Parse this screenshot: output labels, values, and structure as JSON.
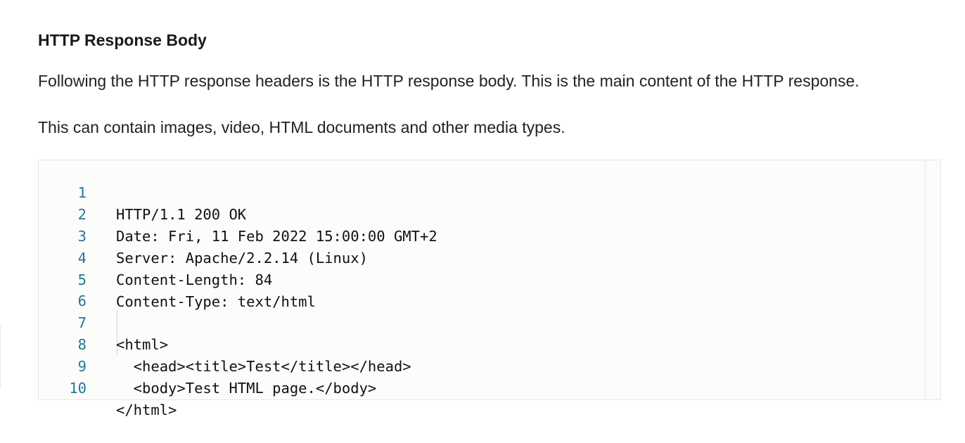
{
  "section": {
    "heading": "HTTP Response Body",
    "paragraphs": [
      "Following the HTTP response headers is the HTTP response body. This is the main content of the HTTP response.",
      "This can contain images, video, HTML documents and other media types."
    ]
  },
  "code_block": {
    "lines": [
      {
        "number": "1",
        "text": "HTTP/1.1 200 OK"
      },
      {
        "number": "2",
        "text": "Date: Fri, 11 Feb 2022 15:00:00 GMT+2"
      },
      {
        "number": "3",
        "text": "Server: Apache/2.2.14 (Linux)"
      },
      {
        "number": "4",
        "text": "Content-Length: 84"
      },
      {
        "number": "5",
        "text": "Content-Type: text/html"
      },
      {
        "number": "6",
        "text": ""
      },
      {
        "number": "7",
        "text": "<html>"
      },
      {
        "number": "8",
        "text": "  <head><title>Test</title></head>"
      },
      {
        "number": "9",
        "text": "  <body>Test HTML page.</body>"
      },
      {
        "number": "10",
        "text": "</html>"
      }
    ]
  }
}
